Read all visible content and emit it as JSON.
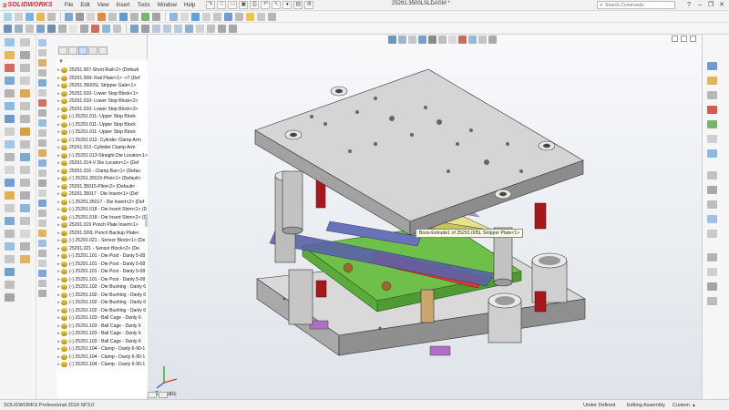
{
  "app": {
    "brand": "SOLIDWORKS",
    "document_title": "25291.3500LSLDASM *",
    "menu": [
      "File",
      "Edit",
      "View",
      "Insert",
      "Tools",
      "Window",
      "Help"
    ]
  },
  "search": {
    "placeholder": "Search Commands"
  },
  "tree": {
    "items": [
      "25291.007-Short Rail<2> (Default",
      "25291.008- Rail Plate<1> ->7 (Def",
      "25291.3500SL Stripper Gate<1>",
      "25291.010- Lower Stop Block<1>",
      "25291.010- Lower Stop Block<2>",
      "25291.010- Lower Stop Block<3>",
      "(-) 25291.011- Upper Stop Block",
      "(-) 25291.011- Upper Stop Block",
      "(-) 25291.011- Upper Stop Block",
      "(-) 25291.012- Cylinder Clamp Arm",
      "25291.012- Cylinder Clamp Arm",
      "(-) 25291.013-Straight Die Locator<1>",
      "25291.014-V Die Locator<1> (Def",
      "25291.016 - Clamp Bar<1> (Defau",
      "(-) 25291.35015-Pilot<1> (Default<",
      "25291.35015-Pilot<2> (Default<",
      "25291.35017 - Die Insert<1> (Def",
      "(-) 25291.35017 - Die Insert<2> (Def",
      "(-) 25291.018 - Die Insert Shim<1> (D",
      "(-) 25291.018 - Die Insert Shim<2> (D",
      "25291.019 Punch Plate Insert<1>",
      "25291.020L Punch Backup Plate<",
      "(-) 25291.021 - Sensor Block<1> (De",
      "25291.021 - Sensor Block<2> (De",
      "(-) 25291.101 - Die Post - Danly 5-08",
      "(-) 25291.101 - Die Post - Danly 5-08",
      "(-) 25291.101 - Die Post - Danly 5-08",
      "(-) 25291.101 - Die Post - Danly 5-08",
      "(-) 25291.102 - Die Bushing - Danly 6",
      "(-) 25291.102 - Die Bushing - Danly 6",
      "(-) 25291.102 - Die Bushing - Danly 6",
      "(-) 25291.102 - Die Bushing - Danly 6",
      "(-) 25291.103 - Ball Cage - Danly 6",
      "(-) 25291.103 - Ball Cage - Danly 6",
      "(-) 25291.103 - Ball Cage - Danly 6",
      "(-) 25291.103 - Ball Cage - Danly 6",
      "(-) 25291.104 - Clamp - Danly 6-90-1",
      "(-) 25291.104 - Clamp - Danly 6-90-1",
      "(-) 25291.104 - Clamp - Danly 6-90-1"
    ]
  },
  "viewport": {
    "tooltip": "Boss-Extrude1 of 25291.005L Stripper Plate<1>",
    "view_name": "*Trimetric"
  },
  "status": {
    "version": "SOLIDWORKS Professional 2019 SP3.0",
    "definition": "Under Defined",
    "mode": "Editing Assembly",
    "units": "Custom"
  }
}
